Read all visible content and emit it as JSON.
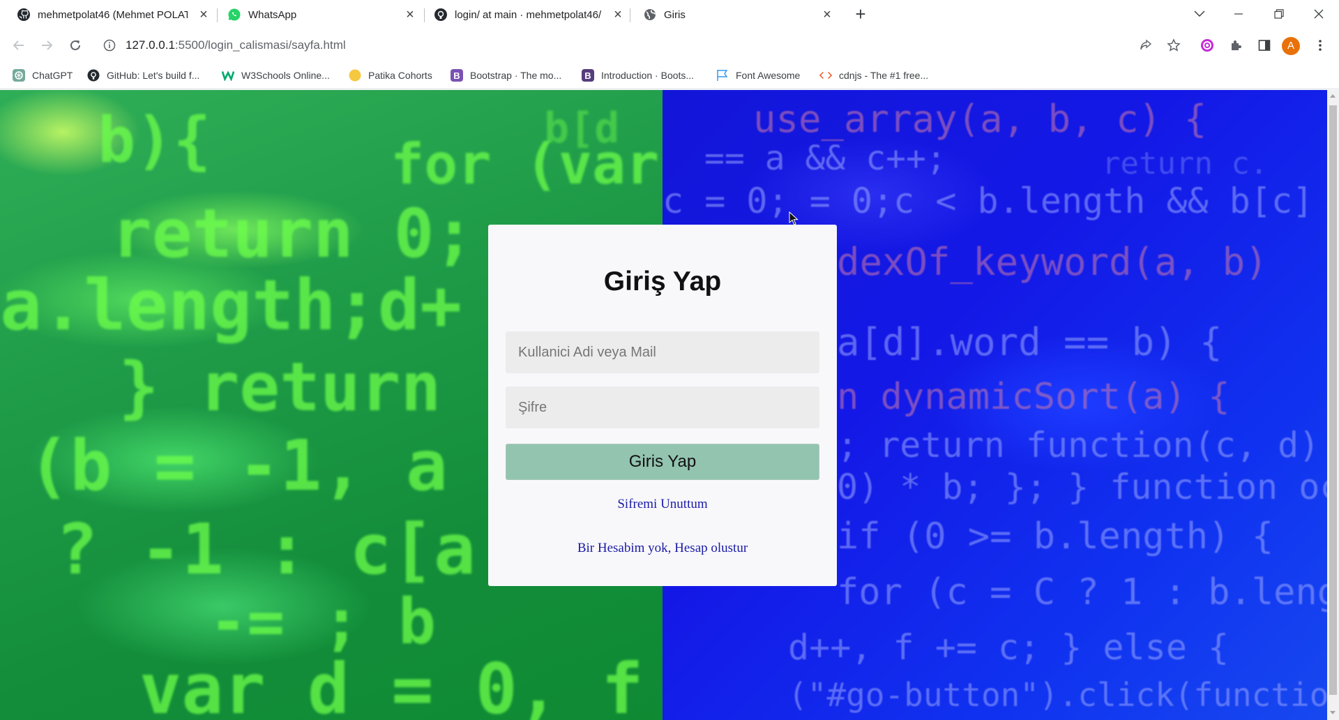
{
  "browser": {
    "tabs": [
      {
        "title": "mehmetpolat46 (Mehmet POLAT)",
        "icon": "github-icon"
      },
      {
        "title": "WhatsApp",
        "icon": "whatsapp-icon"
      },
      {
        "title": "login/ at main · mehmetpolat46/",
        "icon": "github-icon"
      },
      {
        "title": "Giris",
        "icon": "globe-icon"
      }
    ],
    "active_tab": 3,
    "url_host": "127.0.0.1",
    "url_path": ":5500/login_calismasi/sayfa.html",
    "profile_initial": "A",
    "bookmarks": [
      {
        "label": "ChatGPT",
        "icon": "chatgpt-icon"
      },
      {
        "label": "GitHub: Let's build f...",
        "icon": "github-icon"
      },
      {
        "label": "W3Schools Online...",
        "icon": "w3schools-icon"
      },
      {
        "label": "Patika Cohorts",
        "icon": "patika-icon"
      },
      {
        "label": "Bootstrap · The mo...",
        "icon": "bootstrap-icon"
      },
      {
        "label": "Introduction · Boots...",
        "icon": "bootstrap-icon"
      },
      {
        "label": "Font Awesome",
        "icon": "flag-icon"
      },
      {
        "label": "cdnjs - The #1 free...",
        "icon": "code-icon"
      }
    ]
  },
  "page": {
    "heading": "Giriş Yap",
    "username_placeholder": "Kullanici Adi veya Mail",
    "password_placeholder": "Şifre",
    "submit_label": "Giris Yap",
    "forgot_link": "Sifremi Unuttum",
    "signup_link": "Bir Hesabim yok, Hesap olustur"
  },
  "colors": {
    "left_background": "#1e9a47",
    "right_background": "#1418e6",
    "submit_button": "#93c4b0",
    "link": "#1a1aa6"
  }
}
